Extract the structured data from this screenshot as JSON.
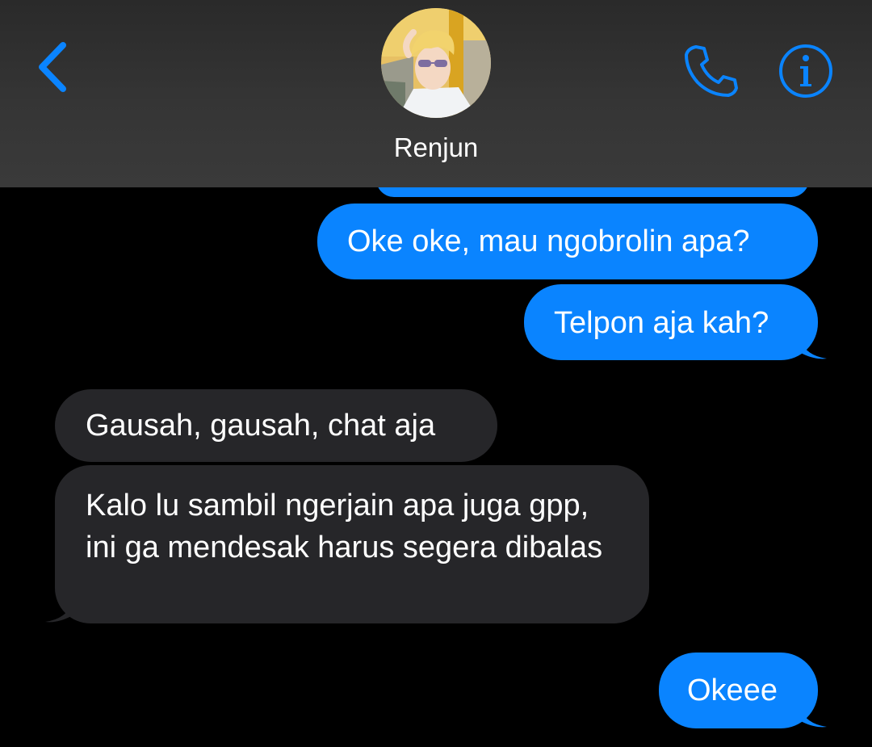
{
  "header": {
    "contact_name": "Renjun"
  },
  "icons": {
    "back": "chevron-left-icon",
    "call": "phone-icon",
    "info": "info-icon"
  },
  "colors": {
    "accent": "#0a84ff",
    "incoming_bubble": "#262629",
    "background": "#000000",
    "header": "#333333"
  },
  "messages": [
    {
      "direction": "outgoing",
      "text": "Oke oke, mau ngobrolin apa?"
    },
    {
      "direction": "outgoing",
      "text": "Telpon aja kah?"
    },
    {
      "direction": "incoming",
      "text": "Gausah, gausah, chat aja"
    },
    {
      "direction": "incoming",
      "text": "Kalo lu sambil ngerjain apa juga gpp, ini ga mendesak harus segera dibalas"
    },
    {
      "direction": "outgoing",
      "text": "Okeee"
    }
  ]
}
